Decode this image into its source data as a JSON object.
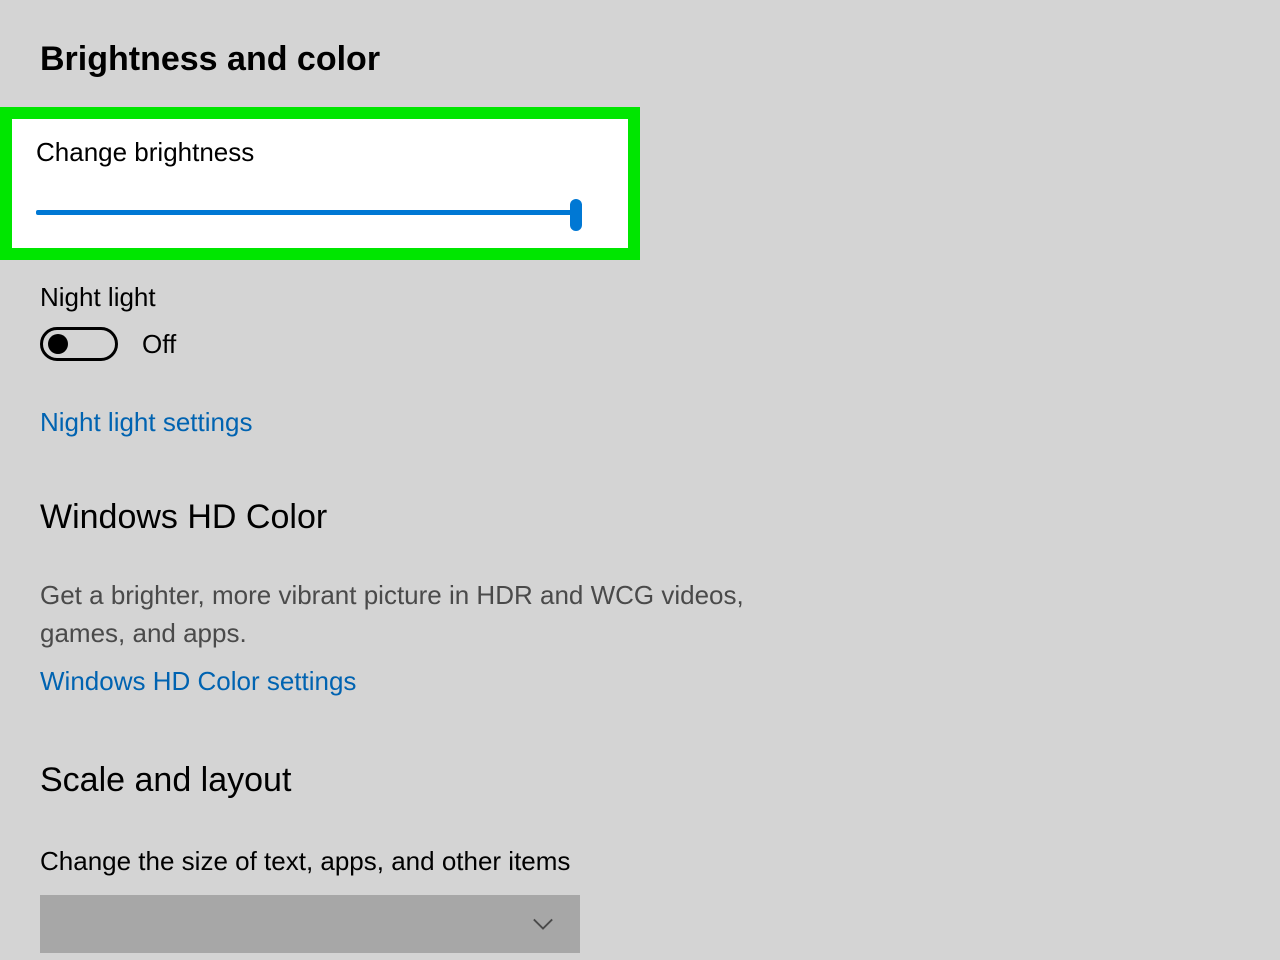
{
  "section_heading": "Brightness and color",
  "brightness": {
    "label": "Change brightness",
    "slider_percent": 100
  },
  "night_light": {
    "label": "Night light",
    "state_text": "Off",
    "link": "Night light settings"
  },
  "hd_color": {
    "heading": "Windows HD Color",
    "description": "Get a brighter, more vibrant picture in HDR and WCG videos, games, and apps.",
    "link": "Windows HD Color settings"
  },
  "scale": {
    "heading": "Scale and layout",
    "label": "Change the size of text, apps, and other items",
    "selected": ""
  },
  "colors": {
    "highlight": "#00e600",
    "accent": "#0078d4",
    "link": "#0063b1"
  }
}
